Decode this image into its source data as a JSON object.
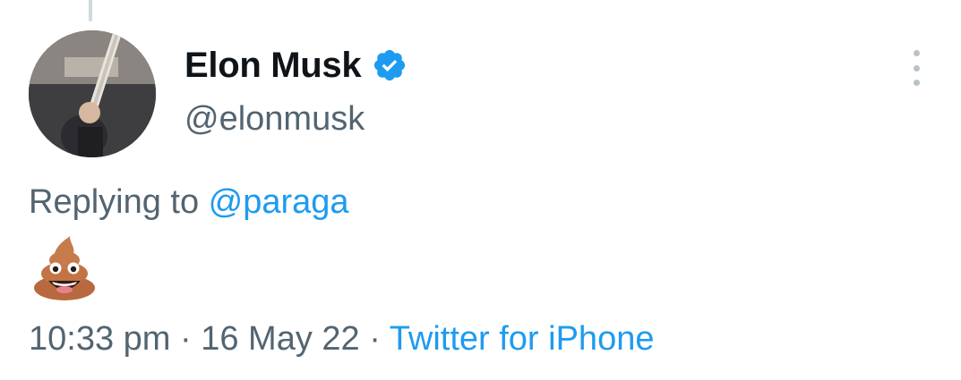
{
  "author": {
    "display_name": "Elon Musk",
    "handle": "@elonmusk",
    "verified_icon": "verified-badge-icon",
    "avatar_icon": "profile-photo"
  },
  "reply": {
    "prefix": "Replying to ",
    "mention": "@paraga"
  },
  "content": {
    "emoji": "pile-of-poo",
    "emoji_char": "💩"
  },
  "meta": {
    "time": "10:33 pm",
    "separator_1": " · ",
    "date": "16 May 22",
    "separator_2": " · ",
    "source": "Twitter for iPhone"
  },
  "more_icon": "more-options-icon",
  "colors": {
    "text_primary": "#0f1419",
    "text_secondary": "#536471",
    "link": "#1d9bf0",
    "verified": "#1d9bf0"
  }
}
